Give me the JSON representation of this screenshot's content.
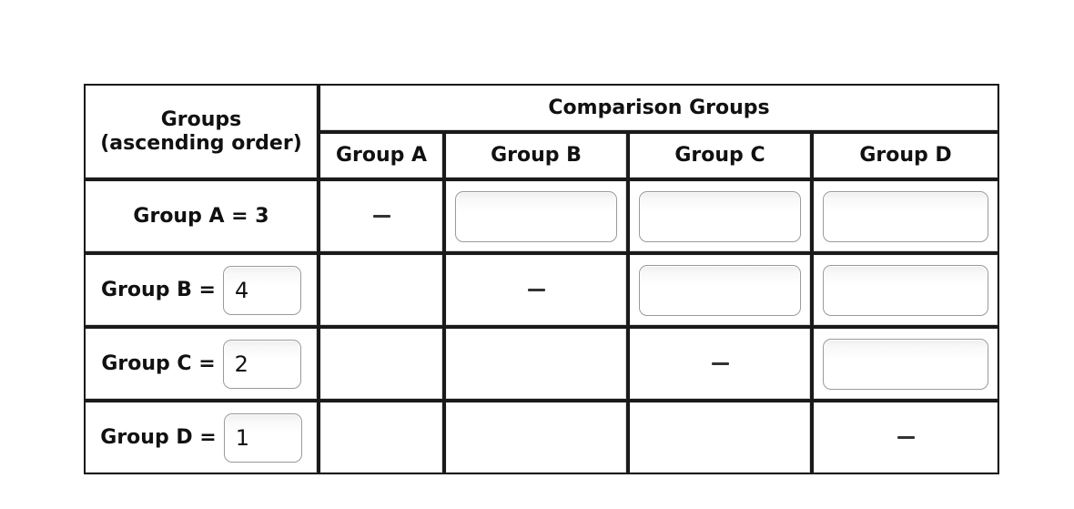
{
  "table": {
    "header": {
      "groups_label_line1": "Groups",
      "groups_label_line2": "(ascending order)",
      "comparison_label": "Comparison Groups",
      "columns": [
        {
          "key": "a",
          "label": "Group A"
        },
        {
          "key": "b",
          "label": "Group B"
        },
        {
          "key": "c",
          "label": "Group C"
        },
        {
          "key": "d",
          "label": "Group D"
        }
      ]
    },
    "rows": [
      {
        "key": "a",
        "label_prefix": "Group A =",
        "value": "3",
        "value_in_input": false,
        "label_full": "Group A = 3",
        "cells": [
          {
            "type": "dash",
            "text": "—"
          },
          {
            "type": "input",
            "value": ""
          },
          {
            "type": "input",
            "value": ""
          },
          {
            "type": "input",
            "value": ""
          }
        ]
      },
      {
        "key": "b",
        "label_prefix": "Group B =",
        "value": "4",
        "value_in_input": true,
        "label_full": "Group B = 4",
        "cells": [
          {
            "type": "empty",
            "value": ""
          },
          {
            "type": "dash",
            "text": "—"
          },
          {
            "type": "input",
            "value": ""
          },
          {
            "type": "input",
            "value": ""
          }
        ]
      },
      {
        "key": "c",
        "label_prefix": "Group C =",
        "value": "2",
        "value_in_input": true,
        "label_full": "Group C = 2",
        "cells": [
          {
            "type": "empty",
            "value": ""
          },
          {
            "type": "empty",
            "value": ""
          },
          {
            "type": "dash",
            "text": "—"
          },
          {
            "type": "input",
            "value": ""
          }
        ]
      },
      {
        "key": "d",
        "label_prefix": "Group D =",
        "value": "1",
        "value_in_input": true,
        "label_full": "Group D = 1",
        "cells": [
          {
            "type": "empty",
            "value": ""
          },
          {
            "type": "empty",
            "value": ""
          },
          {
            "type": "empty",
            "value": ""
          },
          {
            "type": "dash",
            "text": "—"
          }
        ]
      }
    ]
  },
  "colors": {
    "border": "#1a1a1a",
    "input_border": "#9a9a9a",
    "text": "#111111",
    "background": "#ffffff"
  }
}
